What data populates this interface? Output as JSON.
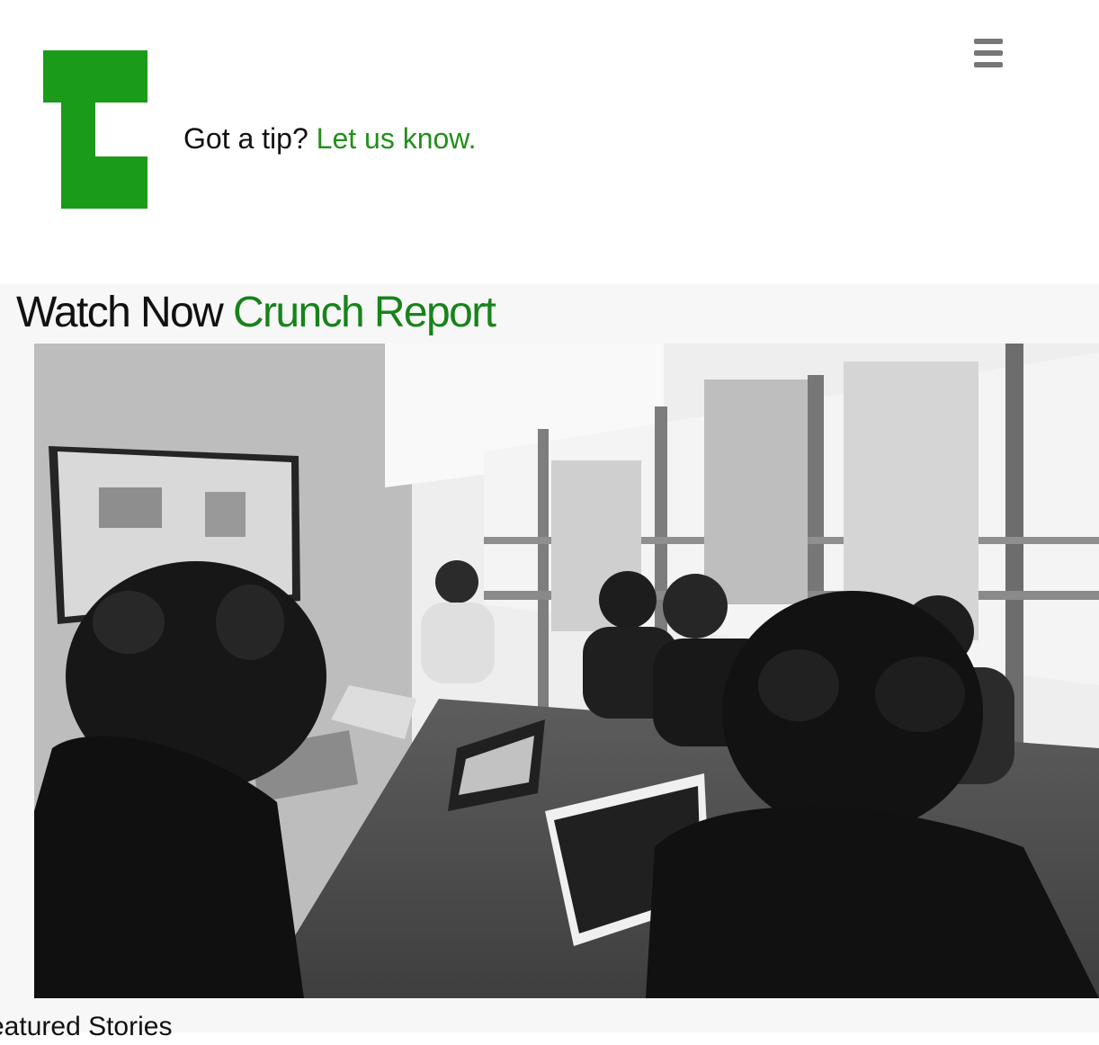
{
  "header": {
    "logo_alt": "TC",
    "tip_prefix": "Got a tip?",
    "tip_link": "Let us know.",
    "menu_icon": "hamburger-menu-icon",
    "brand_color": "#1a9b1a"
  },
  "watch": {
    "title_prefix": "Watch Now",
    "title_link": "Crunch Report",
    "image_description": "Black-and-white photo of a team meeting around a conference table",
    "accent_color": "#17831a"
  },
  "featured": {
    "heading": "eatured Stories"
  }
}
